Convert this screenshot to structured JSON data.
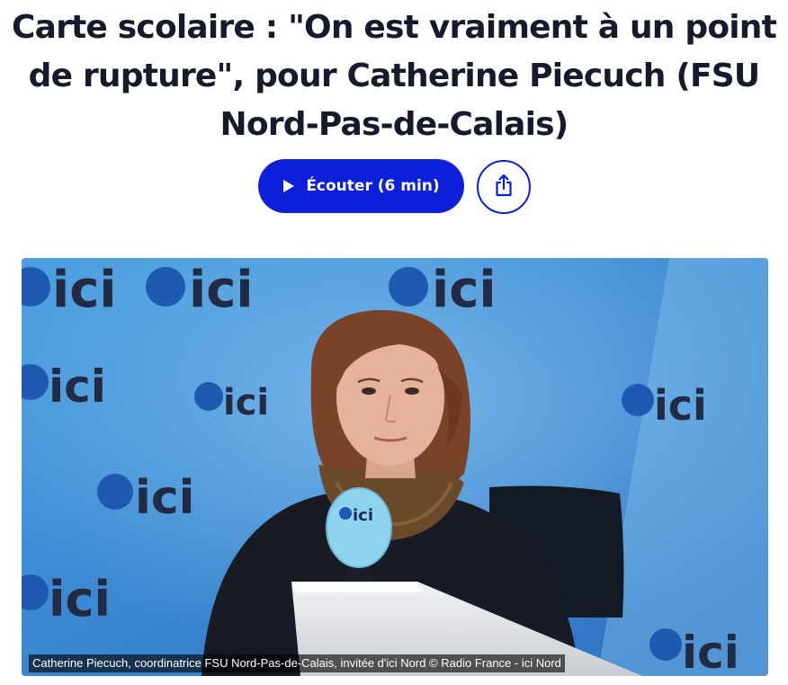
{
  "article": {
    "title": "Carte scolaire : \"On est vraiment à un point de rupture\", pour Catherine Piecuch (FSU Nord-Pas-de-Calais)"
  },
  "actions": {
    "listen_label": "Écouter (6 min)",
    "play_icon": "play-icon",
    "share_icon": "share-icon"
  },
  "photo": {
    "caption": "Catherine Piecuch, coordinatrice FSU Nord-Pas-de-Calais, invitée d'ici Nord © Radio France - ici Nord",
    "logo_text": "ici"
  },
  "colors": {
    "accent": "#0b20d8",
    "title": "#161a2c",
    "backdrop": "#3d8fd6"
  }
}
